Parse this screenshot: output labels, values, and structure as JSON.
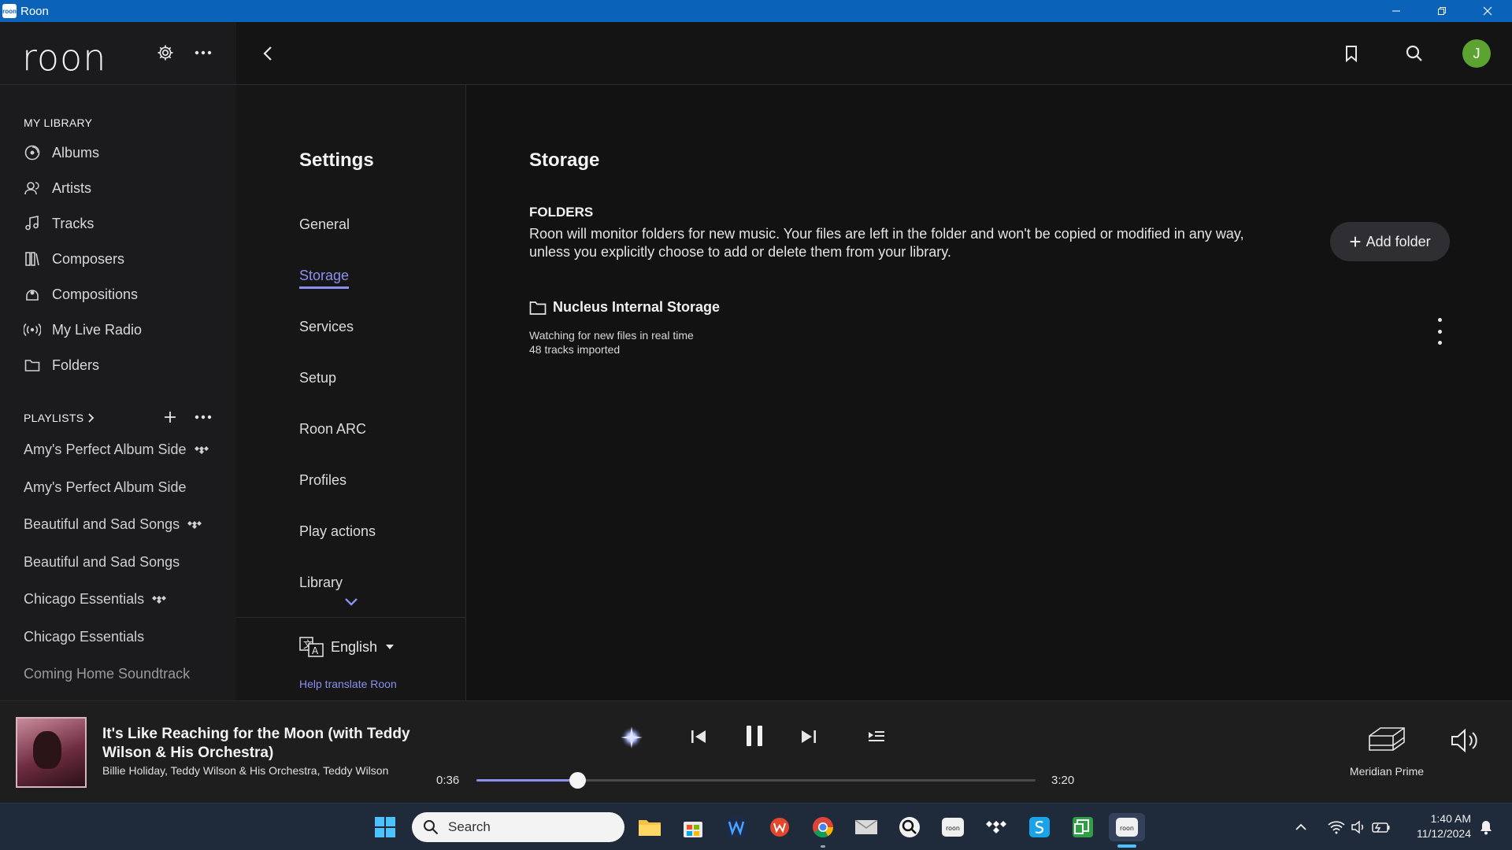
{
  "window": {
    "title": "Roon"
  },
  "sidebar": {
    "logo": "roon",
    "library_title": "MY LIBRARY",
    "library_items": [
      {
        "label": "Albums",
        "icon": "albums-icon"
      },
      {
        "label": "Artists",
        "icon": "artists-icon"
      },
      {
        "label": "Tracks",
        "icon": "tracks-icon"
      },
      {
        "label": "Composers",
        "icon": "composers-icon"
      },
      {
        "label": "Compositions",
        "icon": "compositions-icon"
      },
      {
        "label": "My Live Radio",
        "icon": "radio-icon"
      },
      {
        "label": "Folders",
        "icon": "folder-icon"
      }
    ],
    "playlists_title": "PLAYLISTS",
    "playlists": [
      {
        "label": "Amy's Perfect Album Side",
        "tidal": true
      },
      {
        "label": "Amy's Perfect Album Side",
        "tidal": false
      },
      {
        "label": "Beautiful and Sad Songs",
        "tidal": true
      },
      {
        "label": "Beautiful and Sad Songs",
        "tidal": false
      },
      {
        "label": "Chicago Essentials",
        "tidal": true
      },
      {
        "label": "Chicago Essentials",
        "tidal": false
      },
      {
        "label": "Coming Home Soundtrack",
        "tidal": false
      }
    ]
  },
  "header": {
    "avatar_letter": "J"
  },
  "settings": {
    "title": "Settings",
    "items": [
      "General",
      "Storage",
      "Services",
      "Setup",
      "Roon ARC",
      "Profiles",
      "Play actions",
      "Library"
    ],
    "active": "Storage",
    "language": "English",
    "help_link": "Help translate Roon"
  },
  "storage": {
    "title": "Storage",
    "folders_heading": "FOLDERS",
    "folders_description": "Roon will monitor folders for new music. Your files are left in the folder and won't be copied or modified in any way, unless you explicitly choose to add or delete them from your library.",
    "add_folder_label": "Add folder",
    "folder": {
      "name": "Nucleus Internal Storage",
      "status": "Watching for new files in real time",
      "tracks": "48 tracks imported"
    }
  },
  "player": {
    "title": "It's Like Reaching for the Moon (with Teddy Wilson & His Orchestra)",
    "artists": "Billie Holiday, Teddy Wilson & His Orchestra, Teddy Wilson",
    "elapsed": "0:36",
    "duration": "3:20",
    "progress_fraction": 0.18,
    "zone": "Meridian Prime",
    "accent": "#8b8ff0"
  },
  "taskbar": {
    "search_placeholder": "Search",
    "time": "1:40 AM",
    "date": "11/12/2024"
  }
}
